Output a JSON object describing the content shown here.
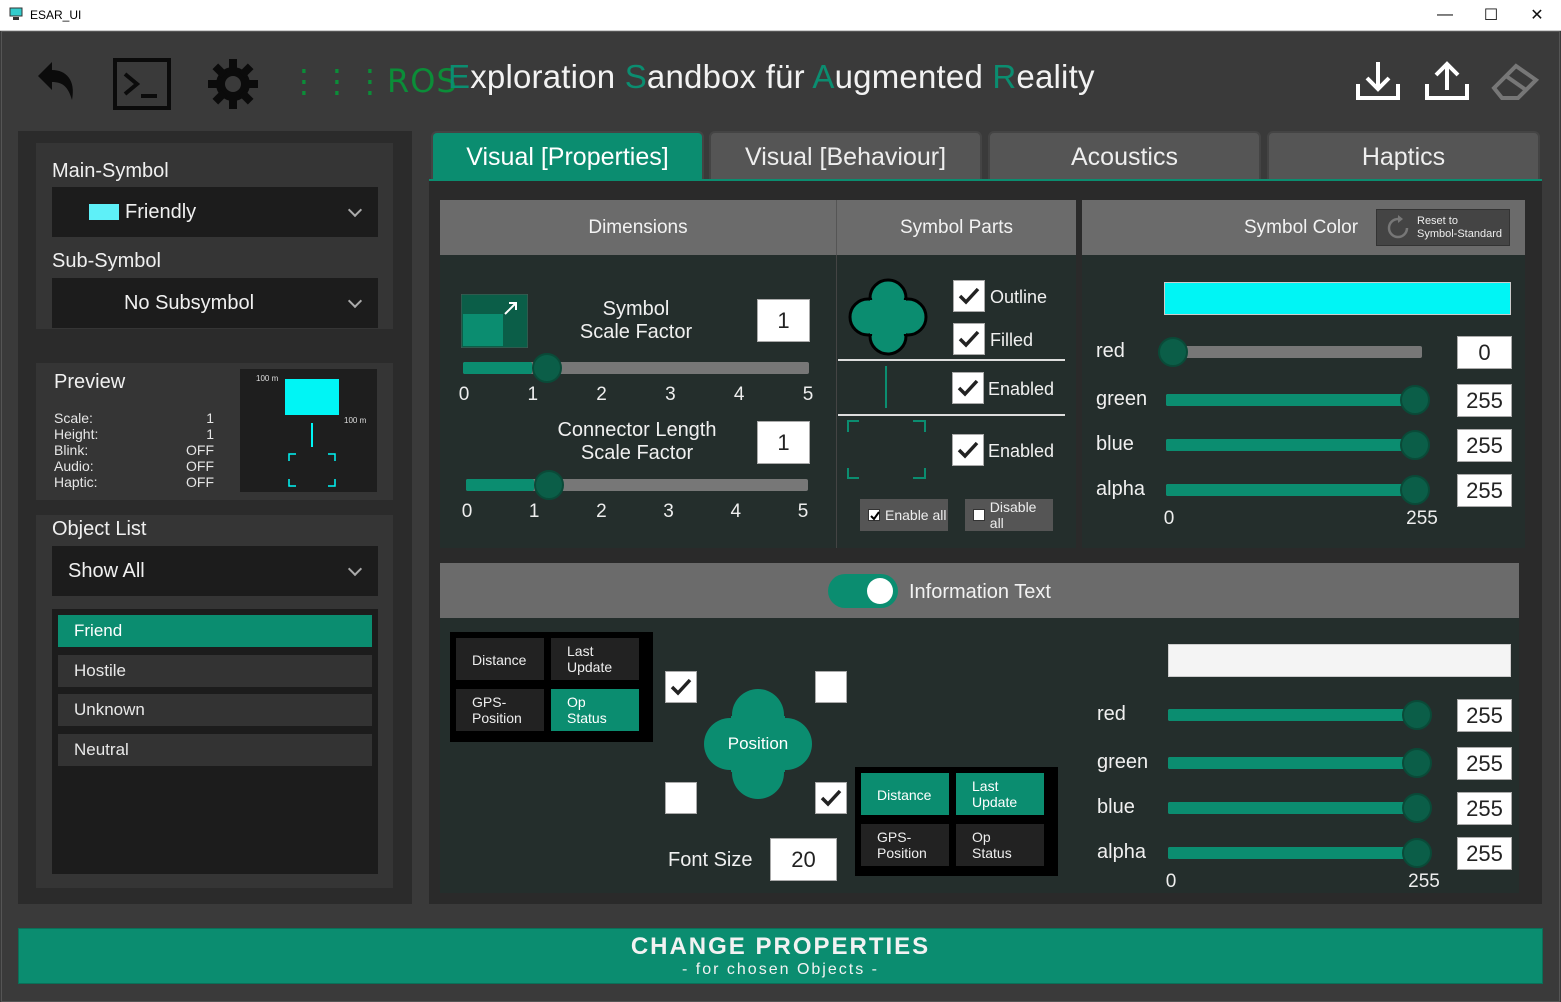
{
  "window": {
    "title": "ESAR_UI",
    "minimize": "—",
    "maximize": "☐",
    "close": "✕"
  },
  "header": {
    "ros_label": "ROS",
    "title_parts": [
      {
        "t": "E",
        "hl": true
      },
      {
        "t": "xploration ",
        "hl": false
      },
      {
        "t": "S",
        "hl": true
      },
      {
        "t": "andbox für ",
        "hl": false
      },
      {
        "t": "A",
        "hl": true
      },
      {
        "t": "ugmented ",
        "hl": false
      },
      {
        "t": "R",
        "hl": true
      },
      {
        "t": "eality",
        "hl": false
      }
    ]
  },
  "left": {
    "main_symbol_label": "Main-Symbol",
    "main_symbol_value": "Friendly",
    "main_symbol_color": "#5ef0f8",
    "sub_symbol_label": "Sub-Symbol",
    "sub_symbol_value": "No Subsymbol",
    "preview": {
      "title": "Preview",
      "stats": [
        {
          "k": "Scale:",
          "v": "1"
        },
        {
          "k": "Height:",
          "v": "1"
        },
        {
          "k": "Blink:",
          "v": "OFF"
        },
        {
          "k": "Audio:",
          "v": "OFF"
        },
        {
          "k": "Haptic:",
          "v": "OFF"
        }
      ],
      "dim_top": "100 m",
      "dim_right": "100 m"
    },
    "object_list_label": "Object List",
    "object_filter": "Show All",
    "objects": [
      {
        "label": "Friend",
        "active": true
      },
      {
        "label": "Hostile",
        "active": false
      },
      {
        "label": "Unknown",
        "active": false
      },
      {
        "label": "Neutral",
        "active": false
      }
    ]
  },
  "tabs": [
    {
      "label": "Visual [Properties]",
      "active": true
    },
    {
      "label": "Visual [Behaviour]",
      "active": false
    },
    {
      "label": "Acoustics",
      "active": false
    },
    {
      "label": "Haptics",
      "active": false
    }
  ],
  "dimensions": {
    "title": "Dimensions",
    "scale_label_1": "Symbol",
    "scale_label_2": "Scale Factor",
    "scale_value": "1",
    "connector_label_1": "Connector Length",
    "connector_label_2": "Scale Factor",
    "connector_value": "1",
    "ticks": [
      "0",
      "1",
      "2",
      "3",
      "4",
      "5"
    ],
    "slider_max": 5,
    "scale_fraction": 0.2,
    "connector_fraction": 0.2
  },
  "symbol_parts": {
    "title": "Symbol Parts",
    "outline_label": "Outline",
    "filled_label": "Filled",
    "connector_enabled_label": "Enabled",
    "base_enabled_label": "Enabled",
    "enable_all": "Enable all",
    "disable_all": "Disable all"
  },
  "symbol_color": {
    "title": "Symbol Color",
    "reset_line1": "Reset to",
    "reset_line2": "Symbol-Standard",
    "swatch": "#00f5f5",
    "channels": [
      {
        "name": "red",
        "value": "0",
        "fraction": 0.0
      },
      {
        "name": "green",
        "value": "255",
        "fraction": 1.0
      },
      {
        "name": "blue",
        "value": "255",
        "fraction": 1.0
      },
      {
        "name": "alpha",
        "value": "255",
        "fraction": 1.0
      }
    ],
    "min_tick": "0",
    "max_tick": "255"
  },
  "info_text": {
    "title": "Information Text",
    "enabled": true,
    "grid_left": [
      {
        "label": "Distance",
        "on": false
      },
      {
        "label": "Last Update",
        "on": false
      },
      {
        "label": "GPS- Position",
        "on": false
      },
      {
        "label": "Op Status",
        "on": true
      }
    ],
    "grid_right": [
      {
        "label": "Distance",
        "on": true
      },
      {
        "label": "Last Update",
        "on": true
      },
      {
        "label": "GPS- Position",
        "on": false
      },
      {
        "label": "Op Status",
        "on": false
      }
    ],
    "position_label": "Position",
    "font_size_label": "Font Size",
    "font_size_value": "20",
    "swatch": "#f4f4f4",
    "channels": [
      {
        "name": "red",
        "value": "255",
        "fraction": 1.0
      },
      {
        "name": "green",
        "value": "255",
        "fraction": 1.0
      },
      {
        "name": "blue",
        "value": "255",
        "fraction": 1.0
      },
      {
        "name": "alpha",
        "value": "255",
        "fraction": 1.0
      }
    ],
    "min_tick": "0",
    "max_tick": "255"
  },
  "footer": {
    "title": "CHANGE PROPERTIES",
    "subtitle": "- for chosen Objects -"
  },
  "colors": {
    "accent": "#0b8d70",
    "ros": "#0b8d38"
  }
}
